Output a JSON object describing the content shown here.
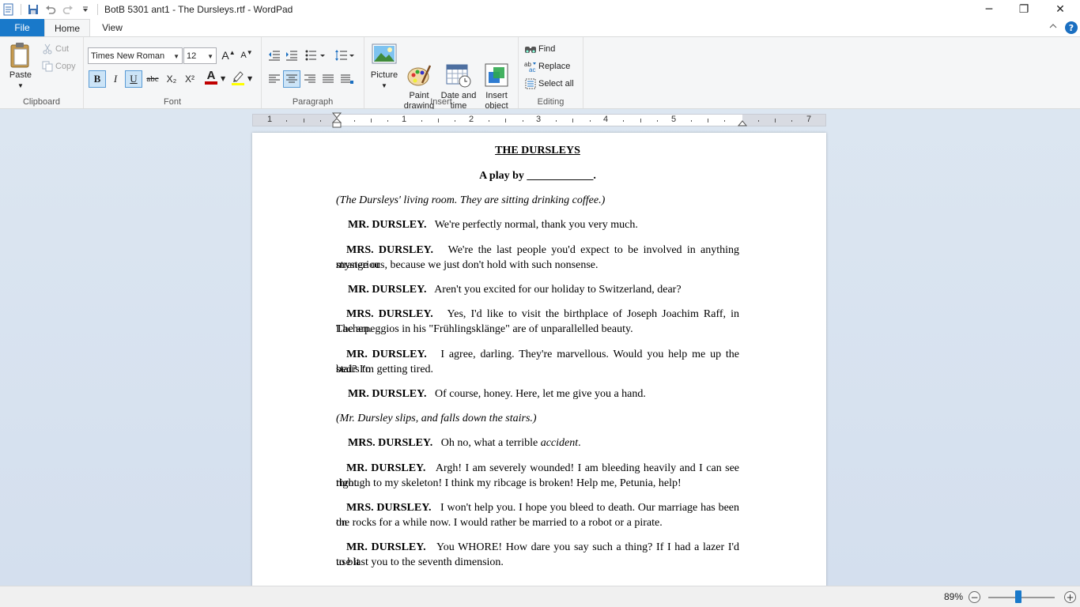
{
  "window": {
    "title": "BotB 5301 ant1 - The Dursleys.rtf - WordPad",
    "minimize_glyph": "─",
    "maximize_glyph": "❐",
    "close_glyph": "✕"
  },
  "tabs": [
    {
      "label": "File"
    },
    {
      "label": "Home"
    },
    {
      "label": "View"
    }
  ],
  "help_label": "?",
  "ribbon": {
    "clipboard": {
      "label": "Clipboard",
      "paste": "Paste",
      "cut": "Cut",
      "copy": "Copy"
    },
    "font": {
      "label": "Font",
      "family": "Times New Roman",
      "size": "12",
      "bold": "B",
      "italic": "I",
      "underline": "U",
      "strike": "abc",
      "subscript": "X₂",
      "superscript": "X²",
      "color_letter": "A",
      "grow": "A",
      "shrink": "A",
      "font_color": "#c00000",
      "highlight_color": "#ffff00"
    },
    "paragraph": {
      "label": "Paragraph",
      "align_selected": "center"
    },
    "insert": {
      "label": "Insert",
      "picture": "Picture",
      "paint": "Paint\ndrawing",
      "datetime": "Date and\ntime",
      "object": "Insert\nobject"
    },
    "editing": {
      "label": "Editing",
      "find": "Find",
      "replace": "Replace",
      "select_all": "Select all"
    }
  },
  "ruler": {
    "numbers": [
      "1",
      "1",
      "2",
      "3",
      "4",
      "5",
      "7"
    ]
  },
  "document": {
    "title": "THE  DURSLEYS",
    "byline": "A play by ____________.",
    "paragraphs": [
      {
        "type": "stage",
        "text": "(The Dursleys' living room. They are sitting drinking coffee.)"
      },
      {
        "type": "line",
        "speaker": "MR. DURSLEY.",
        "text": "We're perfectly normal, thank you very much."
      },
      {
        "type": "line",
        "speaker": "MRS.  DURSLEY.",
        "text": "We're the last people you'd expect to be involved in anything strange or",
        "cont": "mysterious, because we just don't hold with such nonsense."
      },
      {
        "type": "line",
        "speaker": "MR. DURSLEY.",
        "text": "Aren't you excited for our holiday to Switzerland, dear?"
      },
      {
        "type": "line",
        "speaker": "MRS.  DURSLEY.",
        "text": "Yes, I'd like to visit the birthplace of Joseph Joachim Raff, in Lachen.",
        "cont": "The arpeggios in his \"Frühlingsklänge\" are of unparallelled beauty."
      },
      {
        "type": "line",
        "speaker": "MR.  DURSLEY.",
        "text": "I agree, darling. They're marvellous. Would you help me up the stairs to",
        "cont": "bed? I'm getting tired."
      },
      {
        "type": "line",
        "speaker": "MR. DURSLEY.",
        "text": "Of course, honey. Here, let me give you a hand."
      },
      {
        "type": "stage",
        "text": "(Mr. Dursley slips, and falls down the stairs.)"
      },
      {
        "type": "line",
        "speaker": "MRS. DURSLEY.",
        "text": "Oh no, what a terrible ",
        "emph": "accident",
        "after": "."
      },
      {
        "type": "line",
        "speaker": "MR.  DURSLEY.",
        "text": "Argh! I am severely wounded! I am bleeding heavily and I can see right",
        "cont": "through to my skeleton! I think my ribcage is broken! Help me, Petunia, help!"
      },
      {
        "type": "line",
        "speaker": "MRS.  DURSLEY.",
        "text": "I won't help you. I hope you bleed to death. Our marriage has been on",
        "cont": "the rocks for a while now. I would rather be married to a robot or a pirate."
      },
      {
        "type": "line",
        "speaker": "MR.  DURSLEY.",
        "text": "You WHORE! How dare you say such a thing? If I had a lazer I'd use it",
        "cont": "to blast you to the seventh dimension."
      }
    ]
  },
  "status": {
    "zoom_label": "89%",
    "zoom_value": 0.45,
    "zoom_out": "−",
    "zoom_in": "+"
  },
  "colors": {
    "accent": "#1979ca",
    "workspace": "#dce6f1"
  }
}
